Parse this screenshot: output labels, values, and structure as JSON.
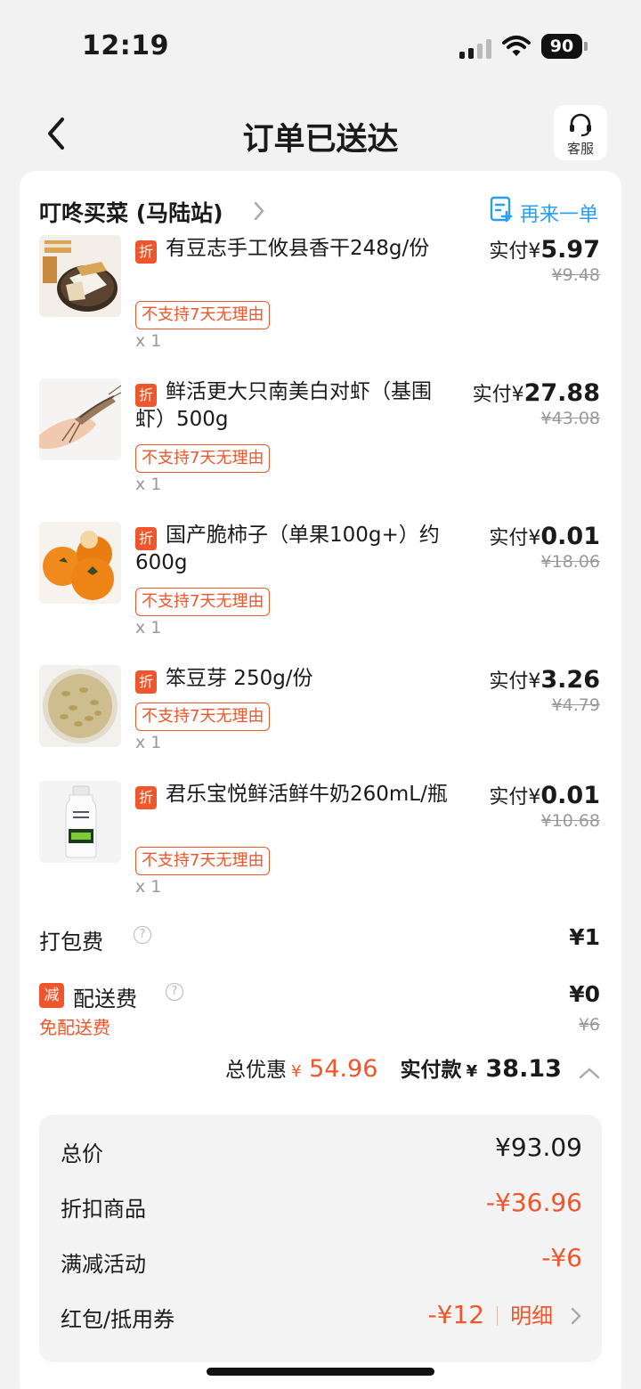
{
  "status_bar": {
    "time": "12:19",
    "battery": "90"
  },
  "nav": {
    "title": "订单已送达",
    "service_label": "客服"
  },
  "store": {
    "name": "叮咚买菜 (马陆站)",
    "reorder_label": "再来一单"
  },
  "items": [
    {
      "badge": "折",
      "name": "有豆志手工攸县香干248g/份",
      "tag": "不支持7天无理由",
      "qty": "x 1",
      "paid_prefix": "实付¥",
      "paid": "5.97",
      "orig": "¥9.48",
      "thumb": "dried-tofu"
    },
    {
      "badge": "折",
      "name": "鲜活更大只南美白对虾（基围虾）500g",
      "tag": "不支持7天无理由",
      "qty": "x 1",
      "paid_prefix": "实付¥",
      "paid": "27.88",
      "orig": "¥43.08",
      "thumb": "shrimp"
    },
    {
      "badge": "折",
      "name": "国产脆柿子（单果100g+）约600g",
      "tag": "不支持7天无理由",
      "qty": "x 1",
      "paid_prefix": "实付¥",
      "paid": "0.01",
      "orig": "¥18.06",
      "thumb": "persimmon"
    },
    {
      "badge": "折",
      "name": "笨豆芽 250g/份",
      "tag": "不支持7天无理由",
      "qty": "x 1",
      "paid_prefix": "实付¥",
      "paid": "3.26",
      "orig": "¥4.79",
      "thumb": "bean-sprouts"
    },
    {
      "badge": "折",
      "name": "君乐宝悦鲜活鲜牛奶260mL/瓶",
      "tag": "不支持7天无理由",
      "qty": "x 1",
      "paid_prefix": "实付¥",
      "paid": "0.01",
      "orig": "¥10.68",
      "thumb": "milk-bottle"
    }
  ],
  "fees": {
    "packing": {
      "label": "打包费",
      "value": "¥1"
    },
    "delivery": {
      "badge": "减",
      "label": "配送费",
      "value": "¥0",
      "orig": "¥6",
      "note": "免配送费"
    }
  },
  "summary": {
    "discount_label": "总优惠",
    "discount_currency": "¥",
    "discount_value": "54.96",
    "paid_label": "实付款",
    "paid_currency": "¥",
    "paid_value": "38.13"
  },
  "breakdown": [
    {
      "label": "总价",
      "value": "¥93.09"
    },
    {
      "label": "折扣商品",
      "value": "-¥36.96"
    },
    {
      "label": "满减活动",
      "value": "-¥6"
    },
    {
      "label": "红包/抵用券",
      "value": "-¥12",
      "link": "明细"
    }
  ],
  "colors": {
    "accent": "#f0562b",
    "link_blue": "#2a9df4",
    "background": "#f2f2f2"
  }
}
